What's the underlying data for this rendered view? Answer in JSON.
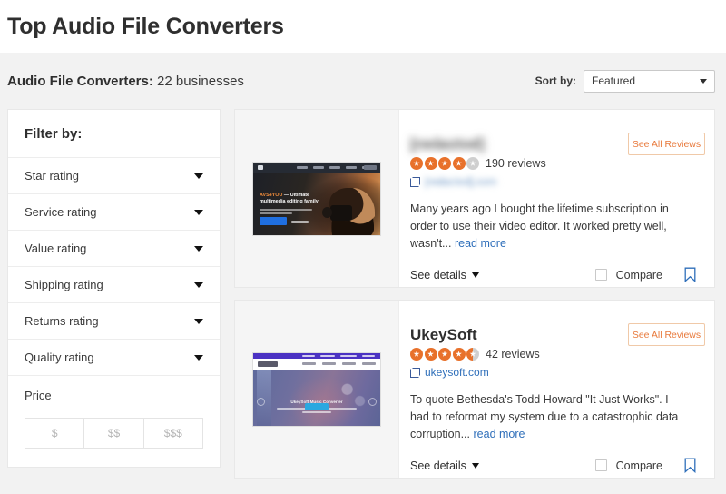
{
  "header": {
    "title": "Top Audio File Converters"
  },
  "results_bar": {
    "category": "Audio File Converters:",
    "count_text": "22 businesses",
    "sort_label": "Sort by:",
    "sort_value": "Featured",
    "sort_options": [
      "Featured"
    ]
  },
  "sidebar": {
    "title": "Filter by:",
    "filters": [
      {
        "label": "Star rating"
      },
      {
        "label": "Service rating"
      },
      {
        "label": "Value rating"
      },
      {
        "label": "Shipping rating"
      },
      {
        "label": "Returns rating"
      },
      {
        "label": "Quality rating"
      }
    ],
    "price": {
      "title": "Price",
      "options": [
        "$",
        "$$",
        "$$$"
      ]
    }
  },
  "colors": {
    "star_filled": "#e8712b",
    "star_empty": "#cfcfcf",
    "link": "#2f6fba",
    "accent_button_border": "#f0c9a8",
    "accent_button_text": "#e8793b",
    "page_background": "#f2f2f2"
  },
  "businesses": [
    {
      "name": "[redacted]",
      "name_redacted": true,
      "rating": 4.0,
      "stars": [
        "full",
        "full",
        "full",
        "full",
        "empty"
      ],
      "reviews_text": "190 reviews",
      "url": "[redacted].com",
      "url_redacted": true,
      "review_snippet": "Many years ago I bought the lifetime subscription in order to use their video editor. It worked pretty well, wasn't...",
      "read_more_label": "read more",
      "see_all_reviews_label": "See All Reviews",
      "see_details_label": "See details",
      "compare_label": "Compare",
      "thumbnail": {
        "type": "avs4you-website",
        "headline_accent": "AVS4YOU",
        "headline_rest": "— Ultimate",
        "headline_line2": "multimedia editing family"
      }
    },
    {
      "name": "UkeySoft",
      "name_redacted": false,
      "rating": 4.5,
      "stars": [
        "full",
        "full",
        "full",
        "full",
        "half"
      ],
      "reviews_text": "42 reviews",
      "url": "ukeysoft.com",
      "url_redacted": false,
      "review_snippet": "To quote Bethesda's Todd Howard \"It Just Works\". I had to reformat my system due to a catastrophic data corruption...",
      "read_more_label": "read more",
      "see_all_reviews_label": "See All Reviews",
      "see_details_label": "See details",
      "compare_label": "Compare",
      "thumbnail": {
        "type": "ukeysoft-website",
        "headline": "UkeySoft Music Converter"
      }
    }
  ]
}
